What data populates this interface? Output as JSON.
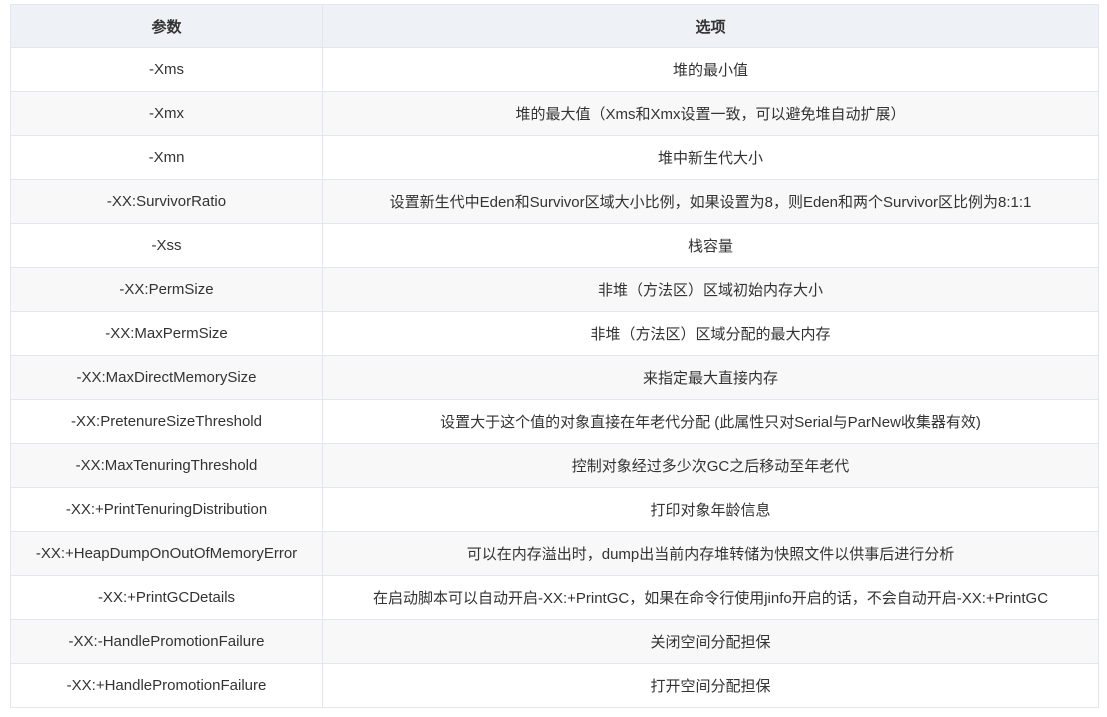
{
  "table": {
    "headers": [
      "参数",
      "选项"
    ],
    "rows": [
      {
        "param": "-Xms",
        "desc": "堆的最小值"
      },
      {
        "param": "-Xmx",
        "desc": "堆的最大值（Xms和Xmx设置一致，可以避免堆自动扩展）"
      },
      {
        "param": "-Xmn",
        "desc": "堆中新生代大小"
      },
      {
        "param": "-XX:SurvivorRatio",
        "desc": "设置新生代中Eden和Survivor区域大小比例，如果设置为8，则Eden和两个Survivor区比例为8:1:1"
      },
      {
        "param": "-Xss",
        "desc": "栈容量"
      },
      {
        "param": "-XX:PermSize",
        "desc": "非堆（方法区）区域初始内存大小"
      },
      {
        "param": "-XX:MaxPermSize",
        "desc": "非堆（方法区）区域分配的最大内存"
      },
      {
        "param": "-XX:MaxDirectMemorySize",
        "desc": "来指定最大直接内存"
      },
      {
        "param": "-XX:PretenureSizeThreshold",
        "desc": "设置大于这个值的对象直接在年老代分配 (此属性只对Serial与ParNew收集器有效)"
      },
      {
        "param": "-XX:MaxTenuringThreshold",
        "desc": "控制对象经过多少次GC之后移动至年老代"
      },
      {
        "param": "-XX:+PrintTenuringDistribution",
        "desc": "打印对象年龄信息"
      },
      {
        "param": "-XX:+HeapDumpOnOutOfMemoryError",
        "desc": "可以在内存溢出时，dump出当前内存堆转储为快照文件以供事后进行分析"
      },
      {
        "param": "-XX:+PrintGCDetails",
        "desc": "在启动脚本可以自动开启-XX:+PrintGC，如果在命令行使用jinfo开启的话，不会自动开启-XX:+PrintGC"
      },
      {
        "param": "-XX:-HandlePromotionFailure",
        "desc": "关闭空间分配担保"
      },
      {
        "param": "-XX:+HandlePromotionFailure",
        "desc": "打开空间分配担保"
      }
    ]
  }
}
